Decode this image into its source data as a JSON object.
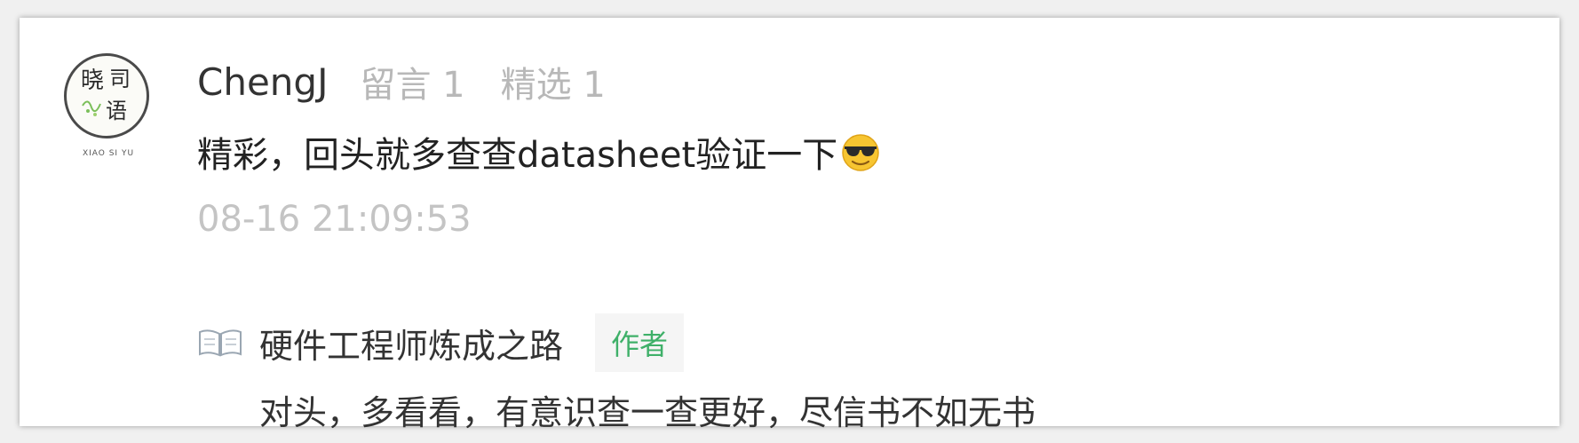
{
  "comment": {
    "username": "ChengJ",
    "comment_count_label": "留言 1",
    "featured_count_label": "精选 1",
    "text": "精彩，回头就多查查datasheet验证一下",
    "emoji": "cool-sunglasses-emoji",
    "timestamp": "08-16 21:09:53",
    "avatar": {
      "characters": [
        "晓",
        "司",
        "语"
      ],
      "caption": "XIAO SI YU"
    }
  },
  "reply": {
    "icon": "book-icon",
    "author": "硬件工程师炼成之路",
    "badge": "作者",
    "text": "对头，多看看，有意识查一查更好，尽信书不如无书"
  },
  "colors": {
    "badge_green": "#3fb069",
    "meta_gray": "#b8b8b8",
    "timestamp_gray": "#c4c4c4"
  }
}
